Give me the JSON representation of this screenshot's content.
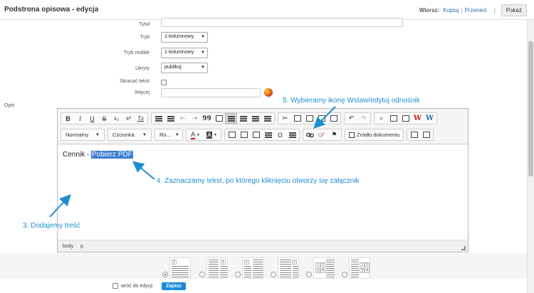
{
  "header": {
    "title": "Podstrona opisowa - edycja",
    "row_label": "Wiersz:",
    "copy_link": "Kopiuj",
    "separator": "|",
    "move_link": "Przenieś",
    "show_button": "Pokaż"
  },
  "form": {
    "title_label": "Tytuł",
    "mode_label": "Tryb",
    "mode_value": "1-kolumnowy",
    "mode_mobile_label": "Tryb mobile",
    "mode_mobile_value": "1-kolumnowy",
    "hidden_label": "Ukryty",
    "hidden_value": "publikuj",
    "shorten_label": "Skracać tekst",
    "more_label": "Więcej",
    "description_label": "Opis"
  },
  "editor": {
    "format_combo": "Normalny",
    "font_combo": "Czcionka",
    "size_combo": "Ro...",
    "source_button": "Źródło dokumentu",
    "content_prefix": "Cennik - ",
    "content_selected": "Pobierz PDF",
    "status_body": "body",
    "status_p": "p",
    "toolbar_glyphs": {
      "bold": "B",
      "italic": "I",
      "underline": "U",
      "strike": "S",
      "subscript": "x₂",
      "superscript": "x²",
      "clear_format": "Tx",
      "quote": "99",
      "text_color": "A",
      "bg_color": "A",
      "special_char": "Ω",
      "find": "⌕",
      "undo": "↶",
      "redo": "↷",
      "cut": "✂",
      "word_w": "W",
      "flag": "⚑"
    }
  },
  "annotations": {
    "step3": "3. Dodajemy treść",
    "step4": "4. Zaznaczamy tekst, po którego kliknięciu otworzy się załącznik",
    "step5": "5. Wybieramy ikonę Wstaw/edytuj odnośnik"
  },
  "layouts": [
    {
      "nums": [
        "1"
      ],
      "selected": true
    },
    {
      "nums": [
        "1"
      ],
      "selected": false
    },
    {
      "nums": [
        "1"
      ],
      "selected": false
    },
    {
      "nums": [
        "1"
      ],
      "selected": false
    },
    {
      "nums": [
        "1",
        "2",
        "3",
        "4"
      ],
      "selected": false
    },
    {
      "nums": [
        "1",
        "2",
        "3",
        "4"
      ],
      "selected": false
    }
  ],
  "footer": {
    "back_label": "wróć do edycji",
    "save_button": "Zapisz"
  },
  "colors": {
    "accent": "#1b8ae0",
    "annotation": "#1c8fd3",
    "selection": "#3a7bd5",
    "link": "#2a6db5"
  }
}
